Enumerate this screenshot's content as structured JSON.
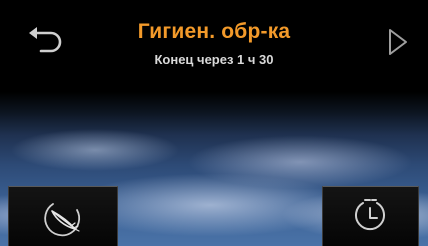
{
  "header": {
    "title": "Гигиен. обр-ка",
    "subtitle": "Конец через 1 ч 30"
  },
  "icons": {
    "back": "undo-arrow-icon",
    "start": "play-triangle-icon",
    "feather": "feather-icon",
    "timer": "clock-timer-icon"
  },
  "colors": {
    "title": "#f39a2a",
    "subtitle": "#d9d9d9"
  }
}
